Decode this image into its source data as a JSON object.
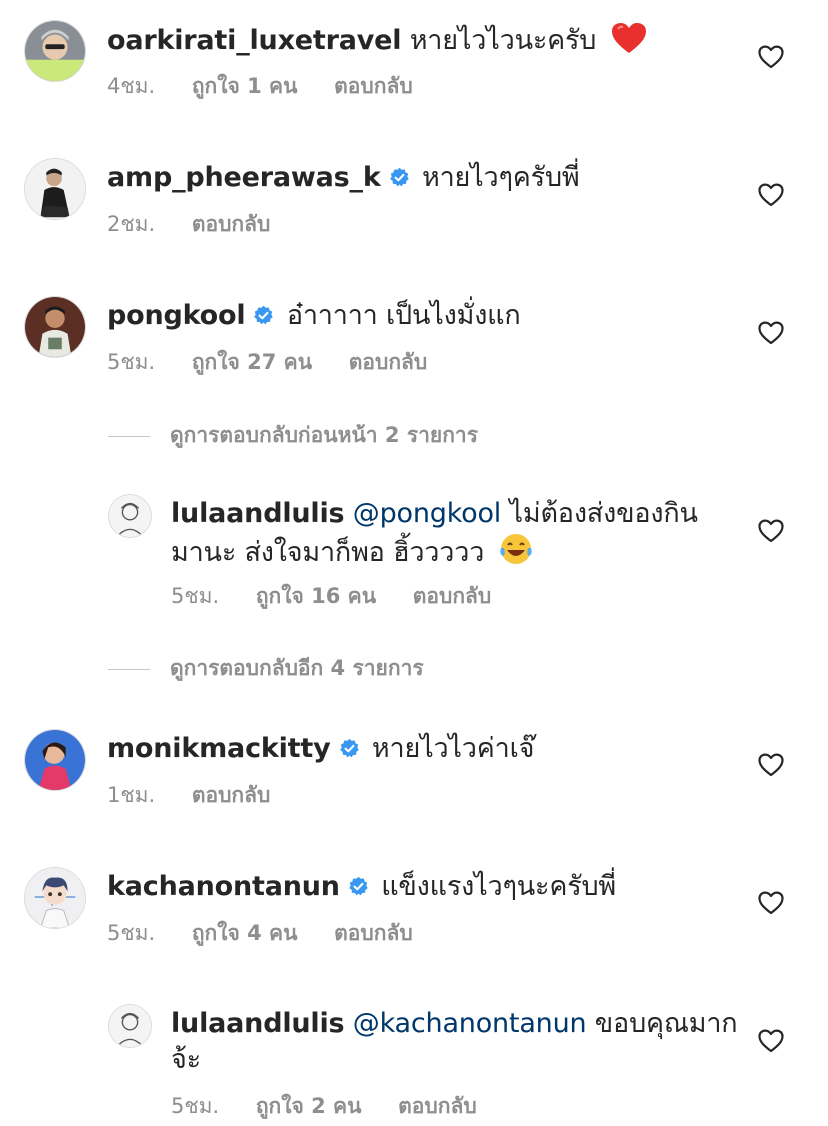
{
  "comments": [
    {
      "username": "oarkirati_luxetravel",
      "text": "หายไวไวนะครับ",
      "emoji": "red-heart",
      "time": "4ชม.",
      "likes": "ถูกใจ 1 คน",
      "reply": "ตอบกลับ"
    },
    {
      "username": "amp_pheerawas_k",
      "text": "หายไวๆครับพี่",
      "verified": true,
      "time": "2ชม.",
      "reply": "ตอบกลับ"
    },
    {
      "username": "pongkool",
      "text": "อ๋าาาาา เป็นไงมั่งแก",
      "verified": true,
      "time": "5ชม.",
      "likes": "ถูกใจ 27 คน",
      "reply": "ตอบกลับ"
    },
    {
      "view_previous": "ดูการตอบกลับก่อนหน้า 2 รายการ",
      "username": "lulaandlulis",
      "mention": "@pongkool",
      "text_line1": "ไม่ต้องส่งของกิน",
      "text_line2": "มานะ ส่งใจมาก็พอ ฮิ้ววววว",
      "emoji": "laughing-tears",
      "time": "5ชม.",
      "likes": "ถูกใจ 16 คน",
      "reply": "ตอบกลับ",
      "view_more": "ดูการตอบกลับอีก 4 รายการ"
    },
    {
      "username": "monikmackitty",
      "text": "หายไวไวค่าเจ๊",
      "verified": true,
      "time": "1ชม.",
      "reply": "ตอบกลับ"
    },
    {
      "username": "kachanontanun",
      "text": "แข็งแรงไวๆนะครับพี่",
      "verified": true,
      "time": "5ชม.",
      "likes": "ถูกใจ 4 คน",
      "reply": "ตอบกลับ"
    },
    {
      "username": "lulaandlulis",
      "mention": "@kachanontanun",
      "text_line1": "ขอบคุณมาก",
      "text_line2": "จ้ะ",
      "time": "5ชม.",
      "likes": "ถูกใจ 2 คน",
      "reply": "ตอบกลับ"
    }
  ],
  "colors": {
    "text": "#262626",
    "meta": "#8e8e8e",
    "mention": "#00376b",
    "verified": "#3897f0",
    "divider": "#c7c7c7"
  }
}
